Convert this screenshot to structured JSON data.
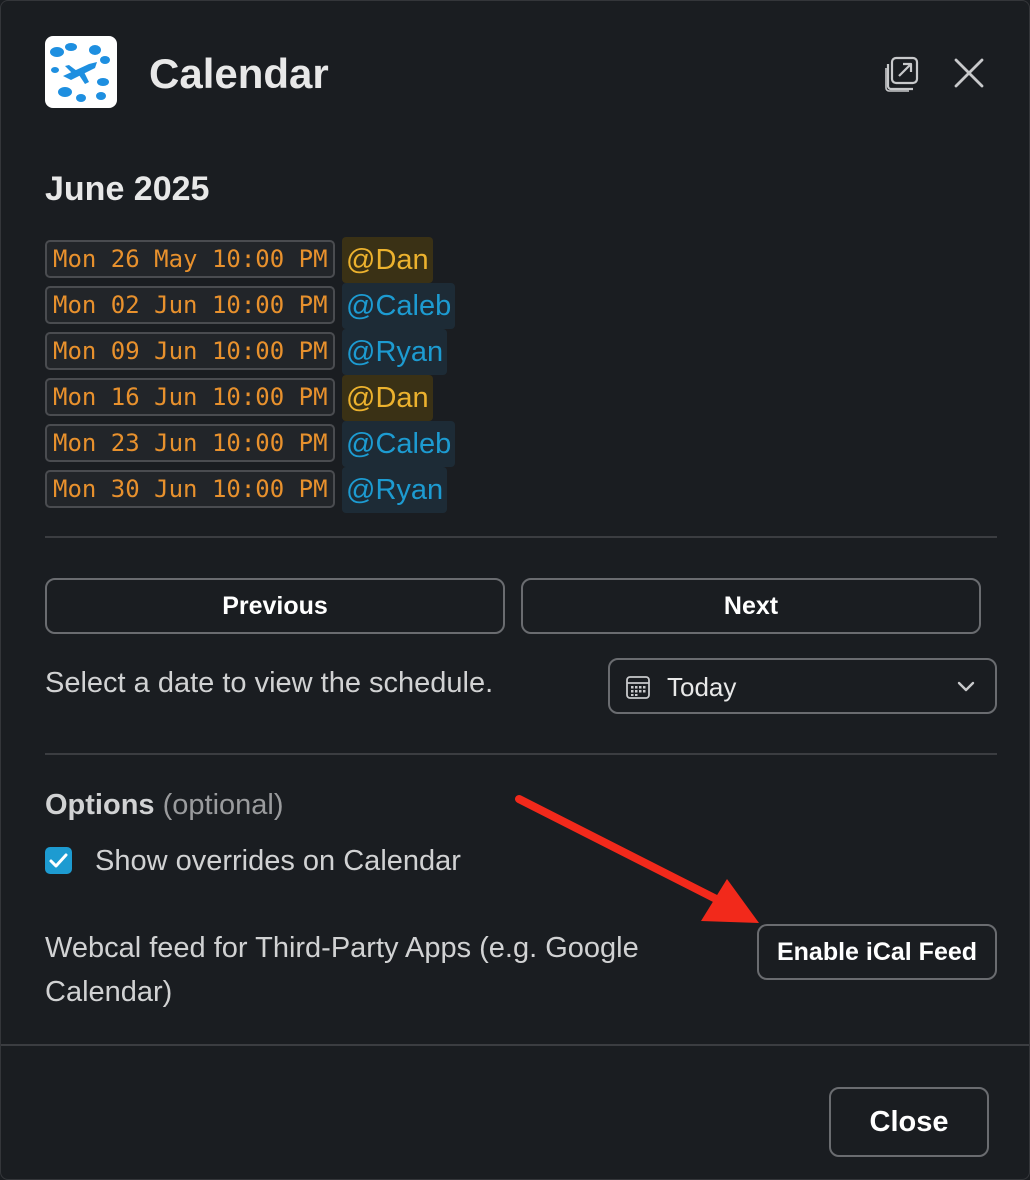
{
  "header": {
    "title": "Calendar",
    "app_icon": "calendar-app-logo",
    "popout_icon": "popout-windows-icon",
    "close_icon": "close-icon"
  },
  "schedule": {
    "month": "June 2025",
    "entries": [
      {
        "date": "Mon 26 May 10:00 PM",
        "user": "@Dan"
      },
      {
        "date": "Mon 02 Jun 10:00 PM",
        "user": "@Caleb"
      },
      {
        "date": "Mon 09 Jun 10:00 PM",
        "user": "@Ryan"
      },
      {
        "date": "Mon 16 Jun 10:00 PM",
        "user": "@Dan"
      },
      {
        "date": "Mon 23 Jun 10:00 PM",
        "user": "@Caleb"
      },
      {
        "date": "Mon 30 Jun 10:00 PM",
        "user": "@Ryan"
      }
    ]
  },
  "navigation": {
    "previous_label": "Previous",
    "next_label": "Next"
  },
  "date_picker": {
    "prompt": "Select a date to view the schedule.",
    "value": "Today"
  },
  "options": {
    "heading": "Options",
    "optional_note": "(optional)",
    "show_overrides_label": "Show overrides on Calendar",
    "show_overrides_checked": true,
    "webcal_text": "Webcal feed for Third-Party Apps (e.g. Google Calendar)",
    "ical_button_label": "Enable iCal Feed"
  },
  "footer": {
    "close_label": "Close"
  },
  "colors": {
    "background": "#1a1d21",
    "date_text": "#e8912d",
    "mention_dan": "#ecb22e",
    "mention_blue": "#1d9bd1",
    "checkbox": "#1d9bd1",
    "annotation_arrow": "#f2291b"
  }
}
